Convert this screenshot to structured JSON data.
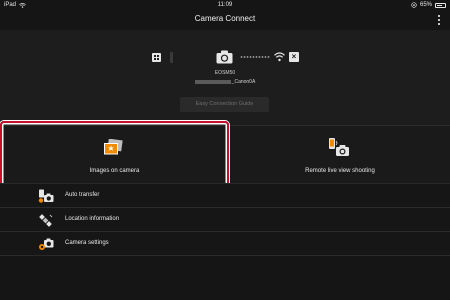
{
  "status_bar": {
    "device": "iPad",
    "time": "11:09",
    "battery": "65%",
    "battery_level": 0.65
  },
  "nav": {
    "title": "Camera Connect"
  },
  "connection": {
    "camera_model": "EOSM50",
    "camera_name_suffix": "_Canon0A",
    "easy_connection_guide_label": "Easy Connection Guide"
  },
  "tiles": {
    "images_on_camera": "Images on camera",
    "remote_live_view": "Remote live view shooting"
  },
  "list": [
    {
      "label": "Auto transfer",
      "icon": "auto-transfer-icon"
    },
    {
      "label": "Location information",
      "icon": "satellite-icon"
    },
    {
      "label": "Camera settings",
      "icon": "camera-settings-icon"
    }
  ],
  "colors": {
    "background": "#151515",
    "highlight": "#c8102e",
    "accent_orange": "#f08a00"
  }
}
